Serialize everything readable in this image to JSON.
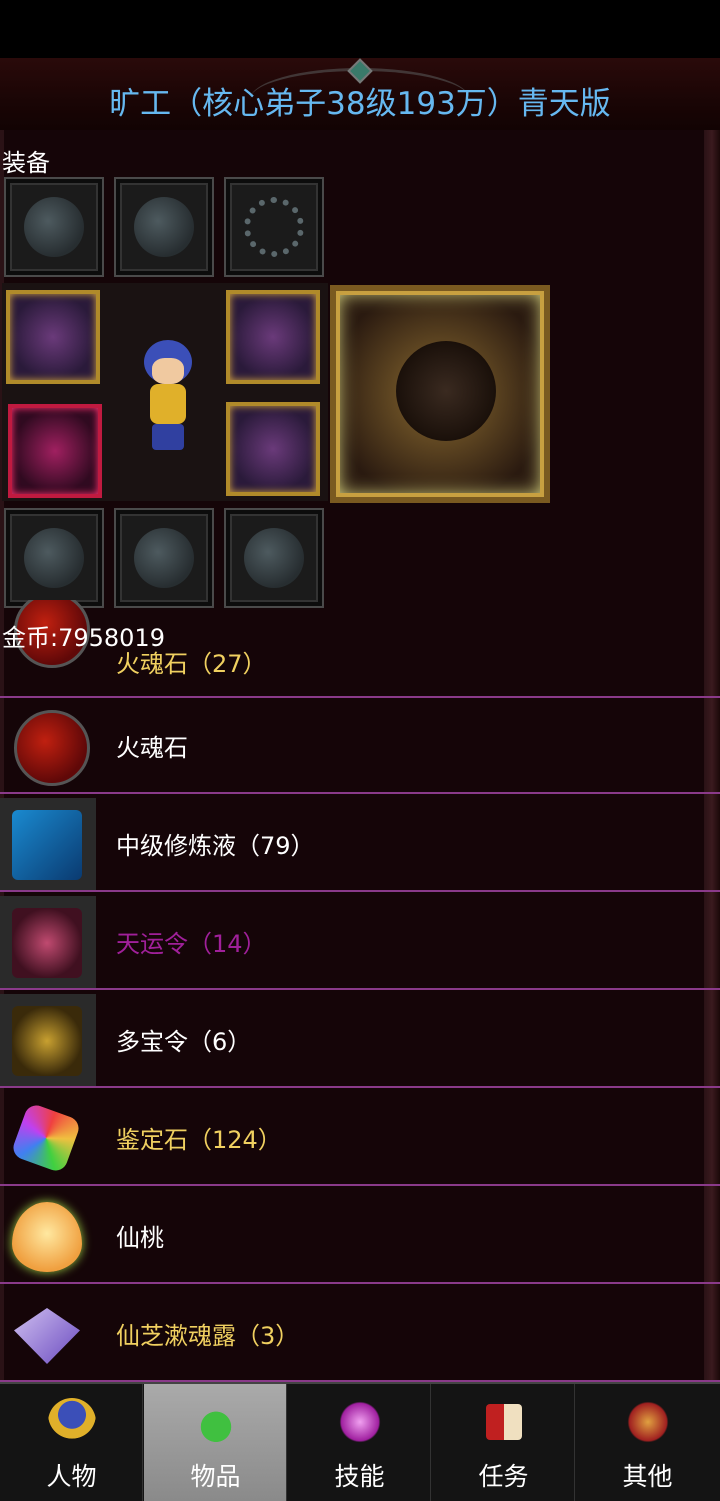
{
  "header": {
    "title": "旷工（核心弟子38级193万）青天版"
  },
  "equipment": {
    "label": "装备",
    "coins_text": "金币:7958019"
  },
  "items": [
    {
      "label": "火魂石（27）",
      "color": "#f0d060",
      "icon": "fire-orb-icon"
    },
    {
      "label": "火魂石",
      "color": "#ffffff",
      "icon": "fire-orb-icon"
    },
    {
      "label": "中级修炼液（79）",
      "color": "#ffffff",
      "icon": "cultivation-potion-icon"
    },
    {
      "label": "天运令（14）",
      "color": "#a0209a",
      "icon": "fortune-token-icon"
    },
    {
      "label": "多宝令（6）",
      "color": "#ffffff",
      "icon": "treasure-token-icon"
    },
    {
      "label": "鉴定石（124）",
      "color": "#f0d060",
      "icon": "identify-gem-icon"
    },
    {
      "label": "仙桃",
      "color": "#ffffff",
      "icon": "peach-icon"
    },
    {
      "label": "仙芝漱魂露（3）",
      "color": "#f0d060",
      "icon": "soul-dew-bottle-icon"
    }
  ],
  "tabs": [
    {
      "label": "人物",
      "icon": "character-icon"
    },
    {
      "label": "物品",
      "icon": "potion-bag-icon",
      "active": true
    },
    {
      "label": "技能",
      "icon": "skill-swirl-icon"
    },
    {
      "label": "任务",
      "icon": "quest-flag-icon"
    },
    {
      "label": "其他",
      "icon": "misc-sword-icon"
    }
  ]
}
